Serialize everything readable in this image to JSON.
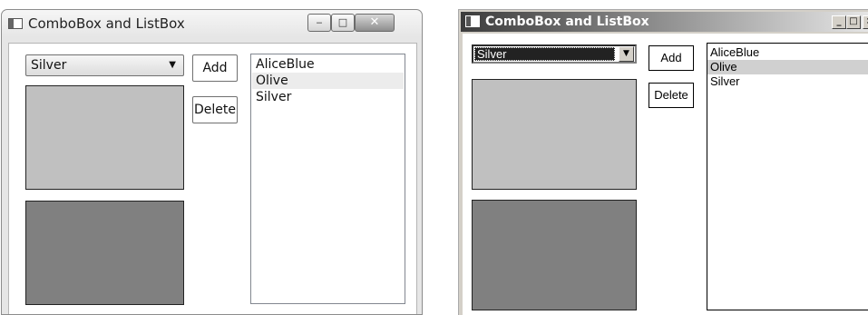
{
  "win7_window": {
    "title": "ComboBox and ListBox",
    "controls": {
      "minimize": "‒",
      "maximize": "□",
      "close": "✕"
    },
    "combobox": {
      "selected": "Silver",
      "arrow": "▼"
    },
    "buttons": {
      "add": "Add",
      "delete": "Delete"
    },
    "listbox": {
      "items": [
        "AliceBlue",
        "Olive",
        "Silver"
      ],
      "selected_index": 1
    },
    "swatches": {
      "top": "#c0c0c0",
      "bottom": "#808080"
    }
  },
  "classic_window": {
    "title": "ComboBox and ListBox",
    "controls": {
      "minimize": "_",
      "maximize": "□",
      "close": "×"
    },
    "combobox": {
      "selected": "Silver",
      "arrow": "▼"
    },
    "buttons": {
      "add": "Add",
      "delete": "Delete"
    },
    "listbox": {
      "items": [
        "AliceBlue",
        "Olive",
        "Silver"
      ],
      "selected_index": 1
    },
    "swatches": {
      "top": "#c0c0c0",
      "bottom": "#808080"
    }
  }
}
